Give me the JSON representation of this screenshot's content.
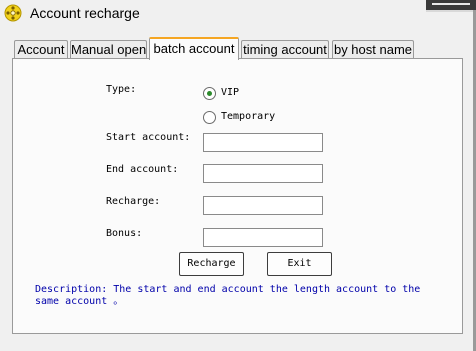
{
  "window": {
    "title": "Account recharge",
    "app_icon": "gear-icon"
  },
  "tabs": [
    {
      "label": "Account",
      "active": false
    },
    {
      "label": "Manual open",
      "active": false
    },
    {
      "label": "batch account",
      "active": true
    },
    {
      "label": "timing account",
      "active": false
    },
    {
      "label": "by host name",
      "active": false
    }
  ],
  "form": {
    "type_label": "Type:",
    "type_options": [
      {
        "label": "VIP",
        "selected": true
      },
      {
        "label": "Temporary",
        "selected": false
      }
    ],
    "start_account_label": "Start account:",
    "start_account_value": "",
    "end_account_label": "End account:",
    "end_account_value": "",
    "recharge_label": "Recharge:",
    "recharge_value": "",
    "bonus_label": "Bonus:",
    "bonus_value": ""
  },
  "buttons": {
    "recharge": "Recharge",
    "exit": "Exit"
  },
  "description": {
    "line1": "Description: The start and end account the length account to the",
    "line2": "same account 。"
  },
  "colors": {
    "active_tab_accent": "#f5a623",
    "description_text": "#0000aa",
    "radio_selected": "#2c8a2c"
  }
}
